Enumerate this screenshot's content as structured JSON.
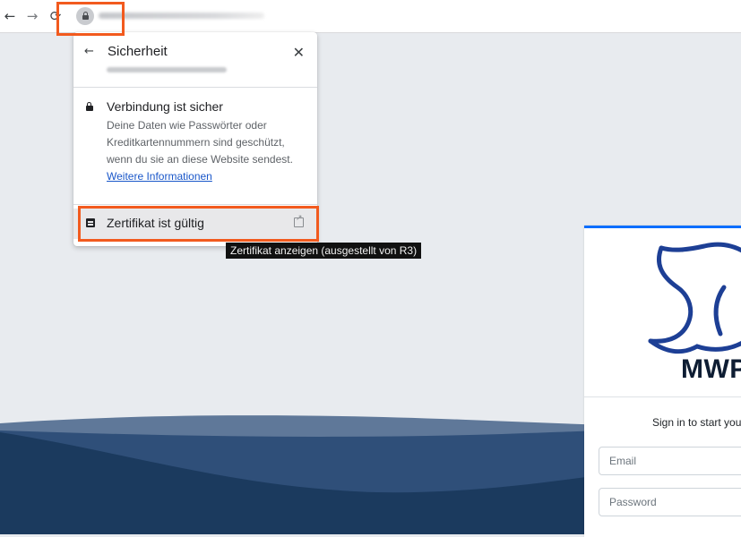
{
  "toolbar": {
    "back_icon": "arrow-left-icon",
    "forward_icon": "arrow-right-icon",
    "reload_icon": "reload-icon",
    "lock_icon": "lock-icon"
  },
  "popup": {
    "title": "Sicherheit",
    "back_icon": "arrow-left-icon",
    "close_icon": "close-icon",
    "connection": {
      "title": "Verbindung ist sicher",
      "description": "Deine Daten wie Passwörter oder Kreditkartennummern sind geschützt, wenn du sie an diese Website sendest. ",
      "link": "Weitere Informationen"
    },
    "certificate": {
      "label": "Zertifikat ist gültig",
      "tooltip": "Zertifikat anzeigen (ausgestellt von R3)"
    }
  },
  "login": {
    "brand": "MWP",
    "message": "Sign in to start you",
    "email_placeholder": "Email",
    "password_placeholder": "Password"
  },
  "colors": {
    "highlight": "#f25a1e",
    "link": "#1a57c9",
    "wave_dark": "#1b3a5e",
    "logo_blue": "#1d3f95"
  }
}
